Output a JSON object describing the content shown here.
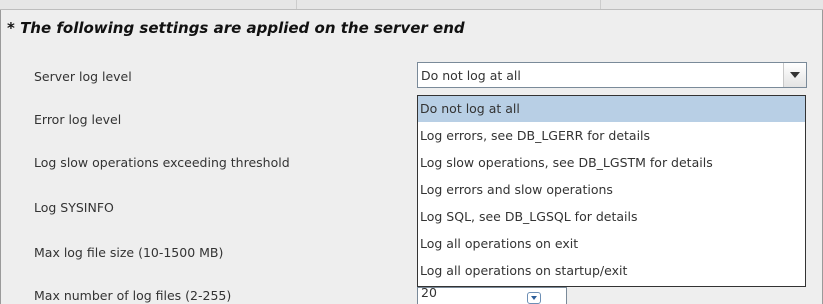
{
  "section": {
    "title": "* The following settings are applied on the server end"
  },
  "rows": {
    "server_log_level": "Server log level",
    "error_log_level": "Error log level",
    "log_slow_ops": "Log slow operations exceeding threshold",
    "log_sysinfo": "Log SYSINFO",
    "max_log_size": "Max log file size (10-1500 MB)",
    "max_log_files": "Max number of log files (2-255)"
  },
  "server_log_combo": {
    "selected": "Do not log at all",
    "options": [
      "Do not log at all",
      "Log errors, see DB_LGERR for details",
      "Log slow operations, see DB_LGSTM for details",
      "Log errors and slow operations",
      "Log SQL, see DB_LGSQL for details",
      "Log all operations on exit",
      "Log all operations on startup/exit"
    ],
    "highlighted_index": 0
  },
  "max_log_files_spinner": {
    "value": "20"
  },
  "colors": {
    "panel_bg": "#eeeeee",
    "selection_bg": "#b8cfe5",
    "spinner_arrow": "#2d5f9a"
  },
  "icons": {
    "combo_arrow": "chevron-down-icon",
    "spinner_arrow": "spinner-down-icon"
  }
}
